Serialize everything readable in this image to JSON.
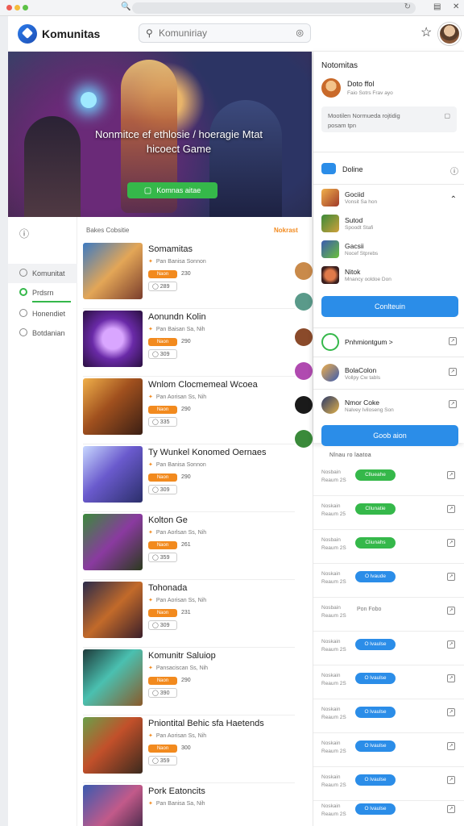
{
  "header": {
    "brand": "Komunitas",
    "search_placeholder": "Komuniriay"
  },
  "hero": {
    "title_line1": "Nonmitce ef ethlosie / hoeragie Mtat",
    "title_line2": "hicoect Game",
    "button_label": "Komnas aitae"
  },
  "leftnav": {
    "items": [
      {
        "label": "Komunitat"
      },
      {
        "label": "Prdsrn"
      },
      {
        "label": "Honendiet"
      },
      {
        "label": "Botdanian"
      }
    ]
  },
  "main": {
    "list_header": "Bakes Cobsitie",
    "list_link": "Nokrast",
    "rows": [
      {
        "title": "Somamitas",
        "sub": "Pan Banisa Sonnon",
        "pill": "Naon",
        "num": "230",
        "chip": "289"
      },
      {
        "title": "Aonundn Kolin",
        "sub": "Pan Baisan Sa, Nih",
        "pill": "Naon",
        "num": "290",
        "chip": "309"
      },
      {
        "title": "Wnlom Clocmemeal Wcoea",
        "sub": "Pan Aorisan Ss, Nih",
        "pill": "Naon",
        "num": "290",
        "chip": "335"
      },
      {
        "title": "Ty Wunkel Konomed Oernaes",
        "sub": "Pan Banisa Sonnon",
        "pill": "Naon",
        "num": "290",
        "chip": "309"
      },
      {
        "title": "Kolton Ge",
        "sub": "Pan Aorlsan Ss, Nih",
        "pill": "Naon",
        "num": "261",
        "chip": "359"
      },
      {
        "title": "Tohonada",
        "sub": "Pan Aorisan Ss, Nih",
        "pill": "Naon",
        "num": "231",
        "chip": "309"
      },
      {
        "title": "Komunitr Saluiop",
        "sub": "Pansaciscan Ss, Nih",
        "pill": "Naon",
        "num": "290",
        "chip": "390"
      },
      {
        "title": "Pniontital Behic sfa Haetends",
        "sub": "Pan Aorisan Ss, Nih",
        "pill": "Naon",
        "num": "300",
        "chip": "359"
      },
      {
        "title": "Pork Eatoncits",
        "sub": "Pan Banisa Sa, Nih",
        "pill": "Naon",
        "num": "",
        "chip": ""
      }
    ]
  },
  "rightpanel": {
    "title": "Notomitas",
    "user": {
      "name": "Doto ffol",
      "sub": "Faio Sotrs Frav ayo"
    },
    "note": {
      "line1": "Mootilen Normueda rojtidig",
      "line2": "posam tpn"
    },
    "online_label": "Doline",
    "friends": [
      {
        "name": "Gociid",
        "sub": "Vonsit Sa hon"
      },
      {
        "name": "Sutod",
        "sub": "Spoodt Stafi"
      },
      {
        "name": "Gacsii",
        "sub": "Nocef Stprebs"
      },
      {
        "name": "Nitok",
        "sub": "Mnancy ooldoe Don"
      }
    ],
    "confirm_button": "Conlteuin",
    "promoted": [
      {
        "name": "Pnhmiontgum >",
        "sub": ""
      },
      {
        "name": "BolaColon",
        "sub": "Vollpy Cw tabls"
      },
      {
        "name": "Nmor Coke",
        "sub": "Nalvey Iviloseng Son"
      }
    ],
    "blue_button2": "Goob aion",
    "cut_header": "Nlnau ro laatoa",
    "bottom_rows": [
      {
        "l1": "Nosbain",
        "l2": "Reaum 2S",
        "pill": "Cllueahe",
        "color": "green"
      },
      {
        "l1": "Noskain",
        "l2": "Reaum 25",
        "pill": "Cllunatie",
        "color": "green"
      },
      {
        "l1": "Nosbain",
        "l2": "Reaum 2S",
        "pill": "Cliunahs",
        "color": "green"
      },
      {
        "l1": "Noskain",
        "l2": "Reaum 2S",
        "pill": "O lvaude",
        "color": "blue"
      },
      {
        "l1": "Nosbain",
        "l2": "Reaum 2S",
        "text": "Pon Fobo"
      },
      {
        "l1": "Noskain",
        "l2": "Reaum 2S",
        "pill": "O lvaulse",
        "color": "blue"
      },
      {
        "l1": "Noskain",
        "l2": "Reaum 2S",
        "pill": "O lvaulse",
        "color": "blue"
      },
      {
        "l1": "Noskain",
        "l2": "Reaum 2S",
        "pill": "O lvaulse",
        "color": "blue"
      },
      {
        "l1": "Noskain",
        "l2": "Reaum 2S",
        "pill": "O lvaulse",
        "color": "blue"
      },
      {
        "l1": "Noskain",
        "l2": "Reaum 2S",
        "pill": "O lvaulse",
        "color": "blue"
      },
      {
        "l1": "Noskain",
        "l2": "Reaum 2S",
        "pill": "O lvaulse",
        "color": "blue"
      }
    ]
  }
}
